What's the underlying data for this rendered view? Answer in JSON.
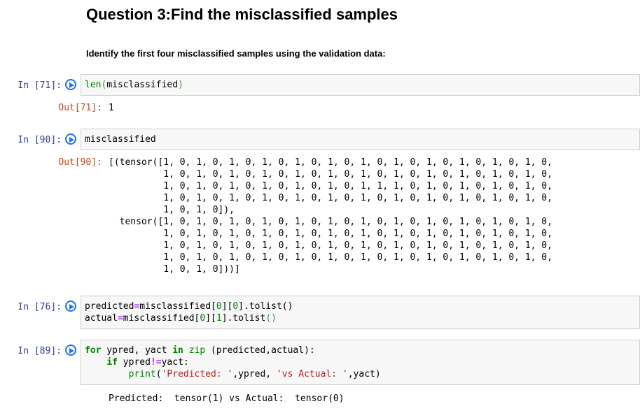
{
  "heading": "Question 3:Find the misclassified samples",
  "instruction": "Identify the first four misclassified samples using the validation data:",
  "cells": [
    {
      "in_prompt": "In [71]:",
      "code": [
        [
          {
            "t": "len",
            "c": "fn"
          },
          {
            "t": "(",
            "c": "par"
          },
          {
            "t": "misclassified",
            "c": ""
          },
          {
            "t": ")",
            "c": "par"
          }
        ]
      ],
      "out_prompt": "Out[71]:",
      "output": [
        "1"
      ]
    },
    {
      "in_prompt": "In [90]:",
      "code": [
        [
          {
            "t": "misclassified",
            "c": ""
          }
        ]
      ],
      "out_prompt": "Out[90]:",
      "output": [
        "[(tensor([1, 0, 1, 0, 1, 0, 1, 0, 1, 0, 1, 0, 1, 0, 1, 0, 1, 0, 1, 0, 1, 0, 1, 0,",
        "          1, 0, 1, 0, 1, 0, 1, 0, 1, 0, 1, 0, 1, 0, 1, 0, 1, 0, 1, 0, 1, 0, 1, 0,",
        "          1, 0, 1, 0, 1, 0, 1, 0, 1, 0, 1, 0, 1, 1, 1, 0, 1, 0, 1, 0, 1, 0, 1, 0,",
        "          1, 0, 1, 0, 1, 0, 1, 0, 1, 0, 1, 0, 1, 0, 1, 0, 1, 0, 1, 0, 1, 0, 1, 0,",
        "          1, 0, 1, 0]),",
        "  tensor([1, 0, 1, 0, 1, 0, 1, 0, 1, 0, 1, 0, 1, 0, 1, 0, 1, 0, 1, 0, 1, 0, 1, 0,",
        "          1, 0, 1, 0, 1, 0, 1, 0, 1, 0, 1, 0, 1, 0, 1, 0, 1, 0, 1, 0, 1, 0, 1, 0,",
        "          1, 0, 1, 0, 1, 0, 1, 0, 1, 0, 1, 0, 1, 0, 1, 0, 1, 0, 1, 0, 1, 0, 1, 0,",
        "          1, 0, 1, 0, 1, 0, 1, 0, 1, 0, 1, 0, 1, 0, 1, 0, 1, 0, 1, 0, 1, 0, 1, 0,",
        "          1, 0, 1, 0]))]"
      ]
    },
    {
      "in_prompt": "In [76]:",
      "code": [
        [
          {
            "t": "predicted",
            "c": ""
          },
          {
            "t": "=",
            "c": "op"
          },
          {
            "t": "misclassified[",
            "c": ""
          },
          {
            "t": "0",
            "c": "num"
          },
          {
            "t": "][",
            "c": ""
          },
          {
            "t": "0",
            "c": "num"
          },
          {
            "t": "].tolist()",
            "c": ""
          }
        ],
        [
          {
            "t": "actual",
            "c": ""
          },
          {
            "t": "=",
            "c": "op"
          },
          {
            "t": "misclassified[",
            "c": ""
          },
          {
            "t": "0",
            "c": "num"
          },
          {
            "t": "][",
            "c": ""
          },
          {
            "t": "1",
            "c": "num"
          },
          {
            "t": "].tolist",
            "c": ""
          },
          {
            "t": "()",
            "c": "par"
          }
        ]
      ]
    },
    {
      "in_prompt": "In [89]:",
      "code": [
        [
          {
            "t": "for",
            "c": "kw"
          },
          {
            "t": " ypred, yact ",
            "c": ""
          },
          {
            "t": "in",
            "c": "kw"
          },
          {
            "t": " ",
            "c": ""
          },
          {
            "t": "zip",
            "c": "fn"
          },
          {
            "t": " (predicted,actual):",
            "c": ""
          }
        ],
        [
          {
            "t": "    ",
            "c": ""
          },
          {
            "t": "if",
            "c": "kw"
          },
          {
            "t": " ypred",
            "c": ""
          },
          {
            "t": "!=",
            "c": "op"
          },
          {
            "t": "yact:",
            "c": ""
          }
        ],
        [
          {
            "t": "        ",
            "c": ""
          },
          {
            "t": "print",
            "c": "fn"
          },
          {
            "t": "(",
            "c": ""
          },
          {
            "t": "'Predicted: '",
            "c": "str"
          },
          {
            "t": ",ypred, ",
            "c": ""
          },
          {
            "t": "'vs Actual: '",
            "c": "str"
          },
          {
            "t": ",yact)",
            "c": ""
          }
        ]
      ],
      "output": [
        "Predicted:  tensor(1) vs Actual:  tensor(0)"
      ]
    }
  ]
}
